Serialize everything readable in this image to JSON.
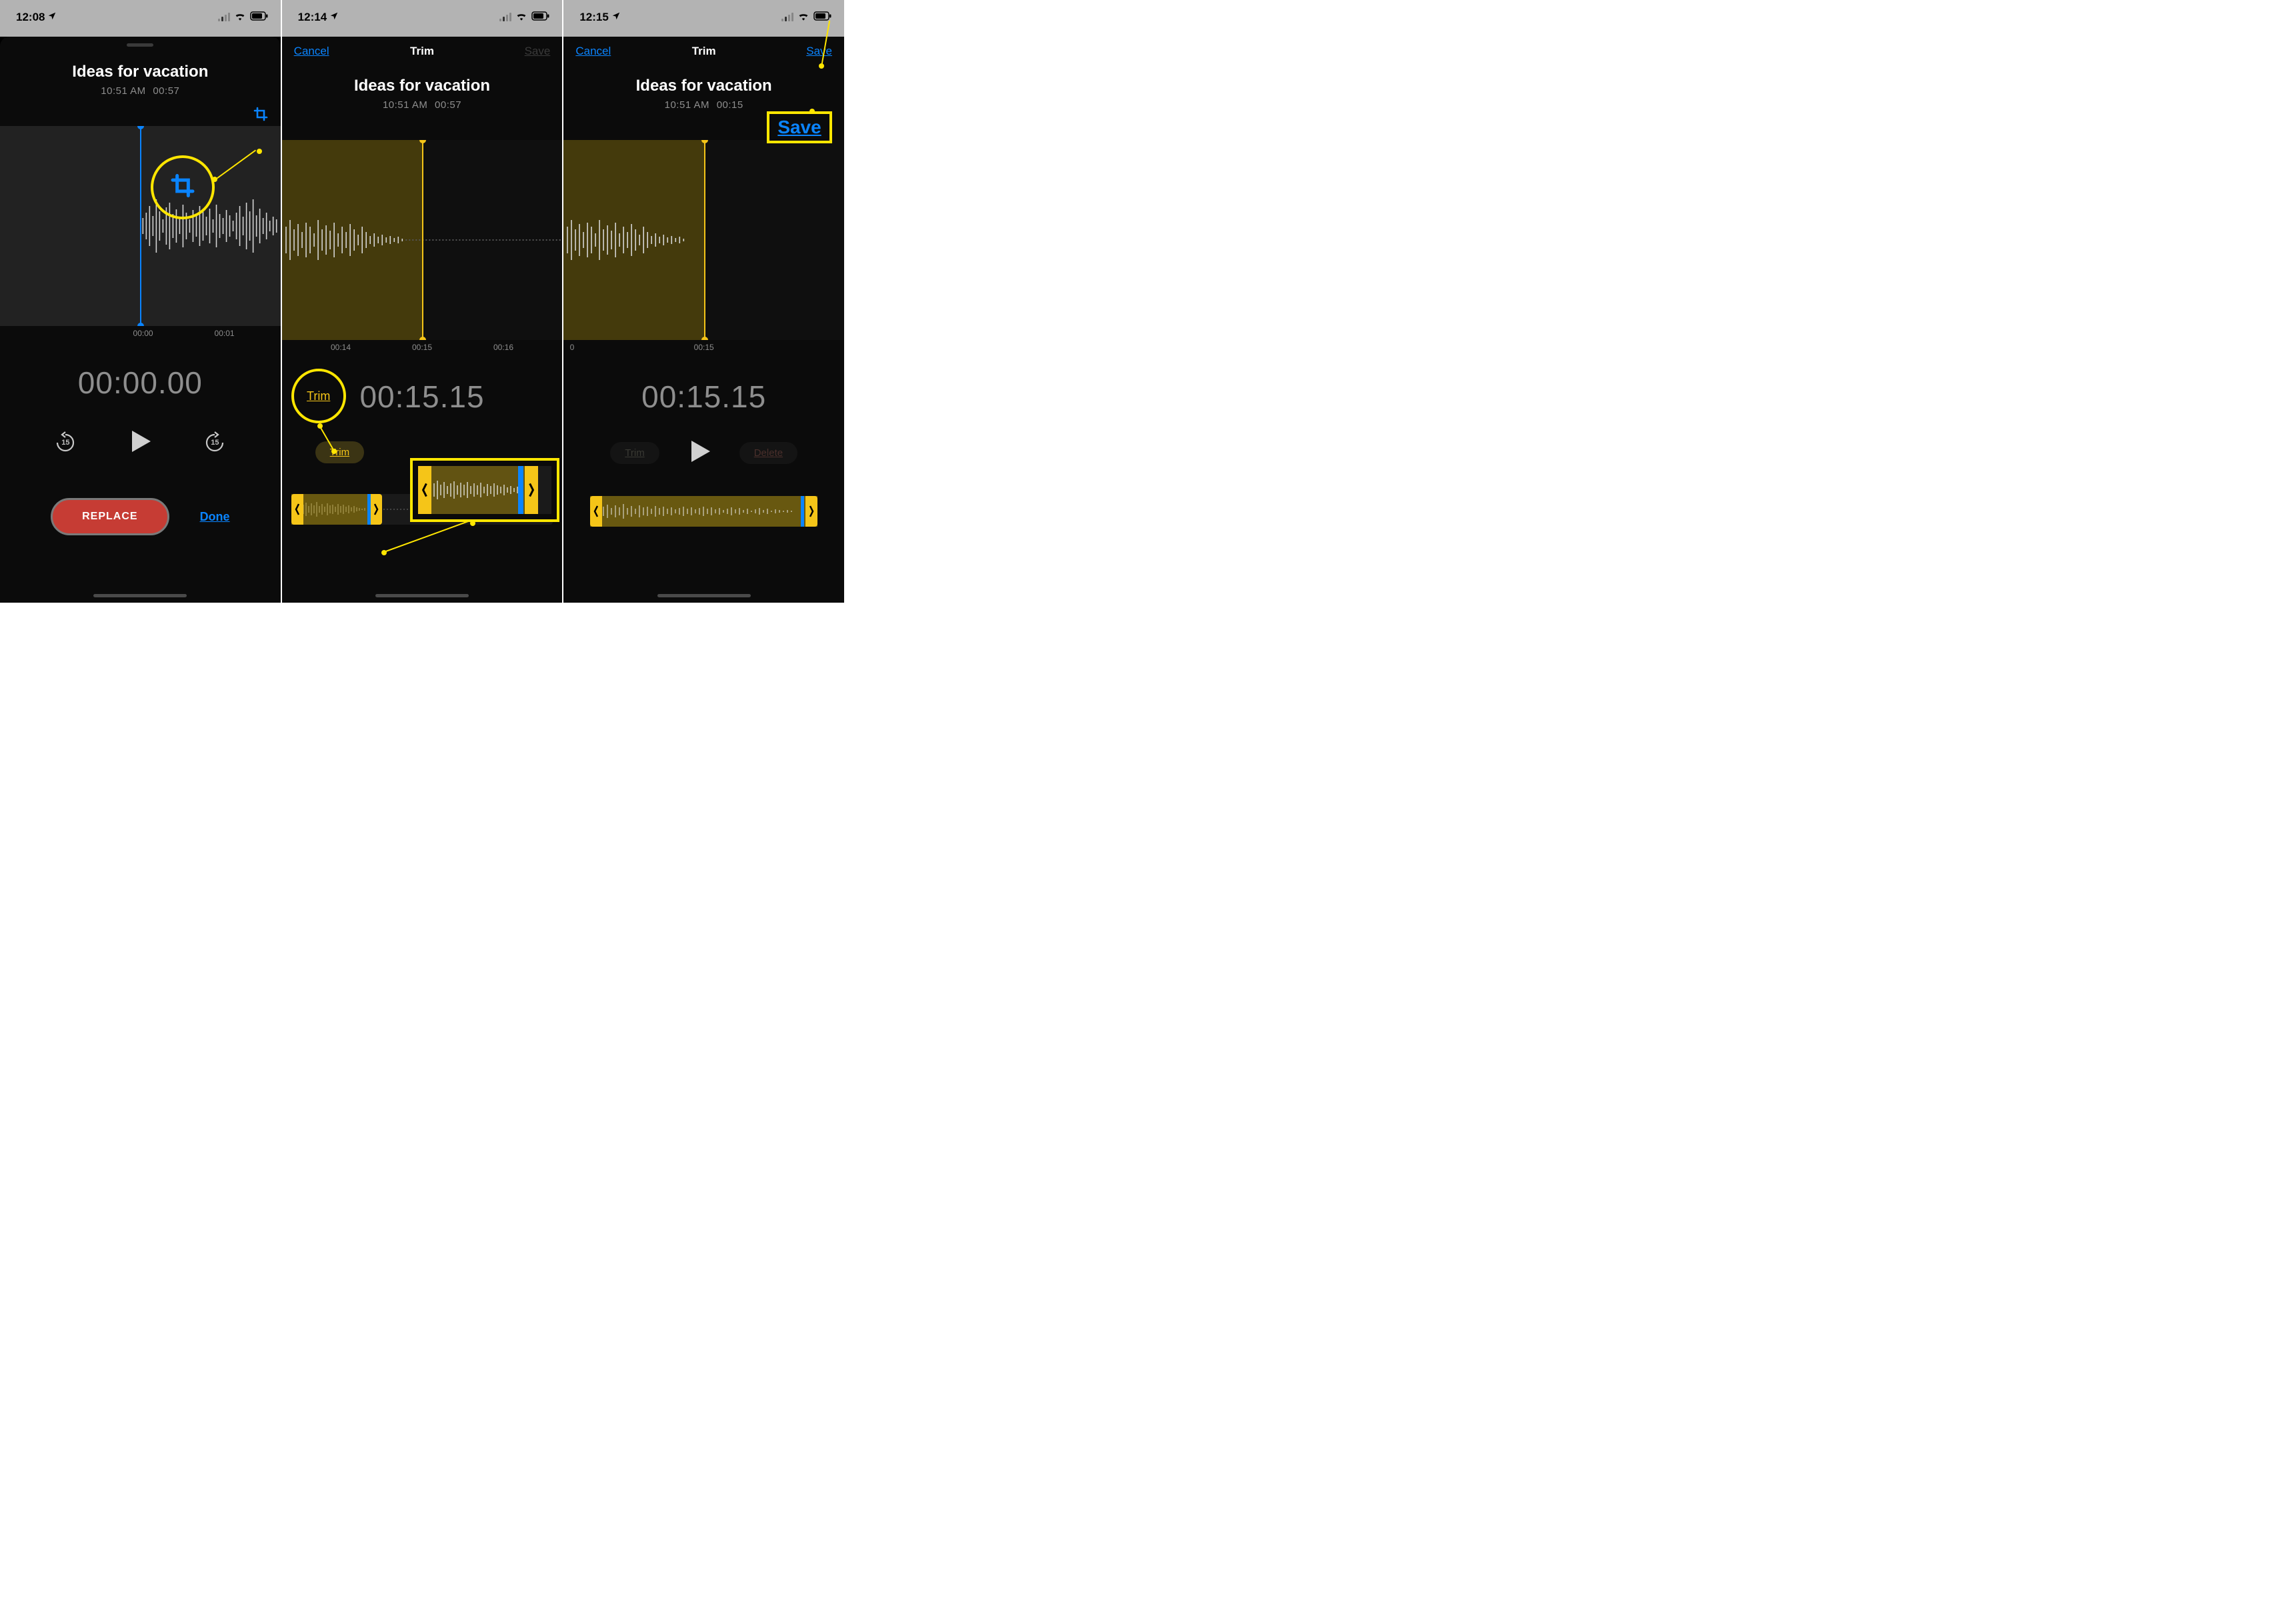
{
  "screens": [
    {
      "status_time": "12:08",
      "title": "Ideas for vacation",
      "meta_time": "10:51 AM",
      "meta_duration": "00:57",
      "ruler_ticks": [
        "00:00",
        "00:01"
      ],
      "big_time": "00:00.00",
      "skip_seconds": "15",
      "replace_label": "REPLACE",
      "done_label": "Done"
    },
    {
      "status_time": "12:14",
      "nav_cancel": "Cancel",
      "nav_title": "Trim",
      "nav_save": "Save",
      "title": "Ideas for vacation",
      "meta_time": "10:51 AM",
      "meta_duration": "00:57",
      "ruler_ticks": [
        "00:14",
        "00:15",
        "00:16"
      ],
      "big_time": "00:15.15",
      "trim_label": "Trim",
      "callout_trim": "Trim"
    },
    {
      "status_time": "12:15",
      "nav_cancel": "Cancel",
      "nav_title": "Trim",
      "nav_save": "Save",
      "title": "Ideas for vacation",
      "meta_time": "10:51 AM",
      "meta_duration": "00:15",
      "ruler_ticks": [
        "0",
        "00:15"
      ],
      "big_time": "00:15.15",
      "trim_label": "Trim",
      "delete_label": "Delete",
      "callout_save": "Save"
    }
  ]
}
